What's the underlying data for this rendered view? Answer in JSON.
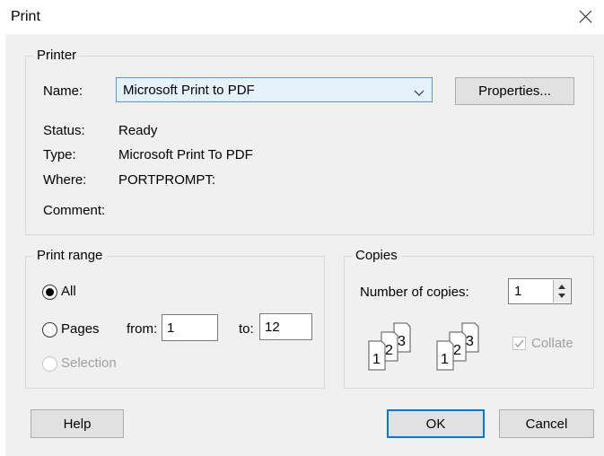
{
  "window": {
    "title": "Print"
  },
  "printer": {
    "group_label": "Printer",
    "name_label": "Name:",
    "name_value": "Microsoft Print to PDF",
    "properties_label": "Properties...",
    "status_label": "Status:",
    "status_value": "Ready",
    "type_label": "Type:",
    "type_value": "Microsoft Print To PDF",
    "where_label": "Where:",
    "where_value": "PORTPROMPT:",
    "comment_label": "Comment:"
  },
  "print_range": {
    "group_label": "Print range",
    "all_label": "All",
    "all_selected": true,
    "pages_label": "Pages",
    "from_label": "from:",
    "from_value": "1",
    "to_label": "to:",
    "to_value": "12",
    "selection_label": "Selection"
  },
  "copies": {
    "group_label": "Copies",
    "number_label": "Number of copies:",
    "number_value": "1",
    "collate_label": "Collate",
    "collate_checked": true,
    "collate_pages": [
      "1",
      "2",
      "3"
    ]
  },
  "buttons": {
    "help": "Help",
    "ok": "OK",
    "cancel": "Cancel"
  },
  "colors": {
    "accent": "#0078d7",
    "dialog_bg": "#f0f0f0",
    "disabled_text": "#a0a0a0"
  }
}
